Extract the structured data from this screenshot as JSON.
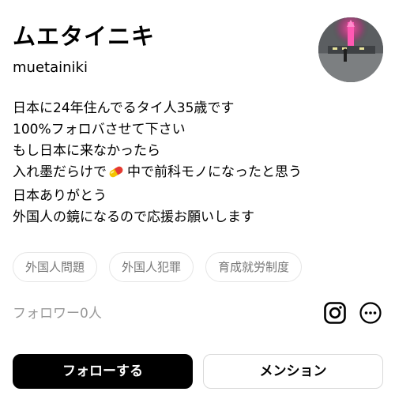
{
  "profile": {
    "display_name": "ムエタイニキ",
    "username": "muetainiki",
    "avatar_icon": "profile-photo-night-tower"
  },
  "bio": {
    "lines": [
      "日本に24年住んでるタイ人35歳です",
      "100%フォロバさせて下さい",
      "もし日本に来なかったら",
      "入れ墨だらけで",
      "日本ありがとう",
      "外国人の鏡になるので応援お願いします"
    ],
    "line4_after_icon": "中で前科モノになったと思う",
    "line4_icon": "pill-emoji"
  },
  "tags": [
    "外国人問題",
    "外国人犯罪",
    "育成就労制度"
  ],
  "followers_text": "フォロワー0人",
  "actions": {
    "instagram_icon": "instagram-icon",
    "more_icon": "more-options-icon",
    "follow_label": "フォローする",
    "mention_label": "メンション"
  },
  "colors": {
    "primary_button_bg": "#000000",
    "primary_button_text": "#ffffff",
    "muted_text": "#999999",
    "tag_text": "#777777",
    "border": "#e6e6e6"
  }
}
